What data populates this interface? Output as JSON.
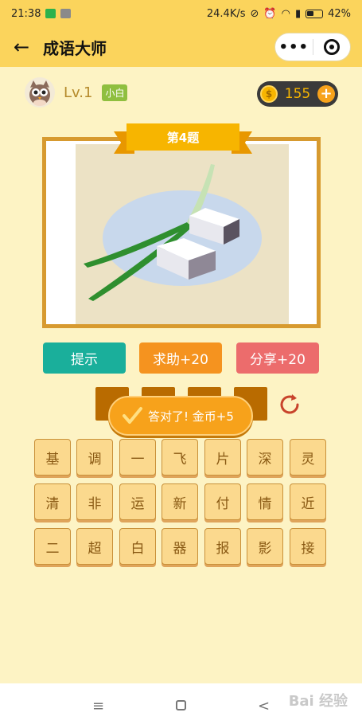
{
  "statusbar": {
    "time": "21:38",
    "network": "24.4K/s",
    "battery": "42%"
  },
  "navbar": {
    "title": "成语大师",
    "back_icon": "←",
    "more_icon": "•••"
  },
  "user": {
    "level": "Lv.1",
    "rank": "小白"
  },
  "coins": {
    "value": "155",
    "add_icon": "+",
    "coin_symbol": "$"
  },
  "question": {
    "label": "第4题"
  },
  "actions": {
    "hint": "提示",
    "help": "求助+20",
    "share": "分享+20"
  },
  "toast": {
    "text": "答对了! 金币+5"
  },
  "keyboard": {
    "rows": [
      [
        "基",
        "调",
        "一",
        "飞",
        "片",
        "深",
        "灵"
      ],
      [
        "清",
        "非",
        "运",
        "新",
        "付",
        "情",
        "近"
      ],
      [
        "二",
        "超",
        "白",
        "器",
        "报",
        "影",
        "接"
      ]
    ]
  },
  "system_nav": {
    "menu": "≡",
    "back": "<"
  },
  "watermark": "Bai 经验",
  "colors": {
    "accent": "#fbd45c",
    "hint": "#1aaf9b",
    "help": "#f5931f",
    "share": "#ec6c6c",
    "slot": "#b96b00"
  }
}
